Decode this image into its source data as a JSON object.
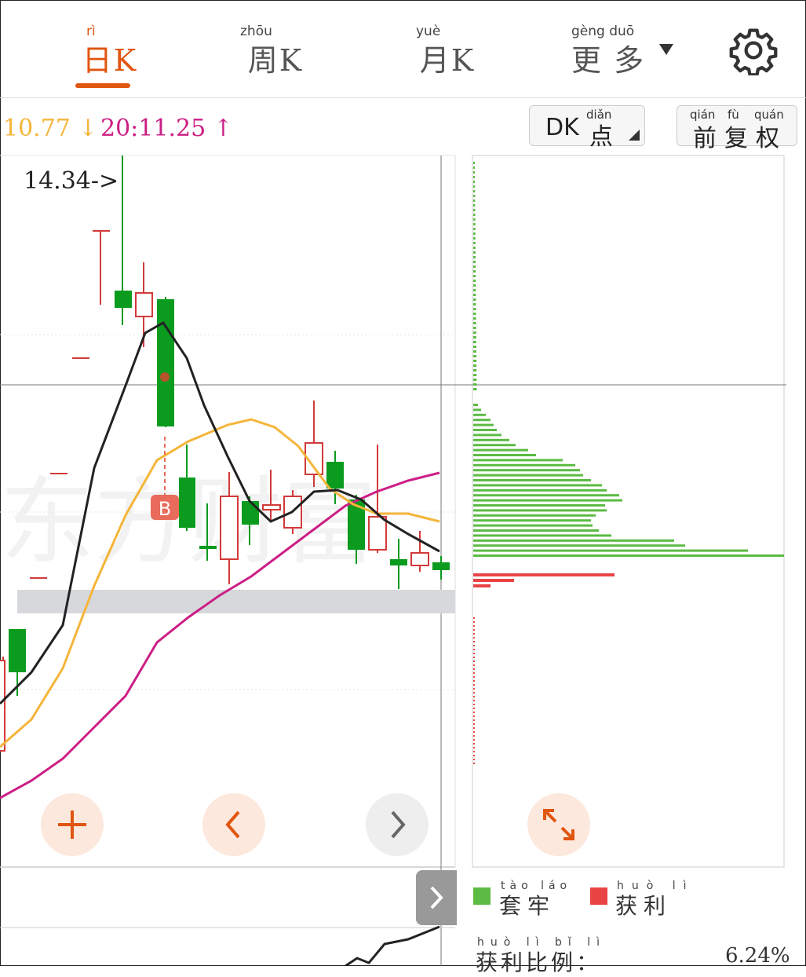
{
  "tabs": [
    {
      "pinyin": "rì",
      "label": "日K",
      "active": true
    },
    {
      "pinyin": "zhōu",
      "label": "周K",
      "active": false
    },
    {
      "pinyin": "yuè",
      "label": "月K",
      "active": false
    },
    {
      "pinyin": "gèng duō",
      "label": "更 多",
      "active": false
    }
  ],
  "ma_values": {
    "ma10": "10.77",
    "ma10_arrow": "↓",
    "ma20": "20:11.25",
    "ma20_arrow": "↑"
  },
  "dk_button": {
    "label": "DK",
    "char": "点",
    "pinyin": "diǎn"
  },
  "fq_button": {
    "chars": "前复权",
    "pinyin": [
      "qián",
      "fù",
      "quán"
    ]
  },
  "chart": {
    "high_label": "14.34->",
    "buy_marker": "B",
    "watermark": "东方财富"
  },
  "legend": {
    "trapped": {
      "pinyin": "tào láo",
      "label": "套牢",
      "color": "#5cbb44"
    },
    "profit": {
      "pinyin": "huò lì",
      "label": "获利",
      "color": "#e84444"
    }
  },
  "profit_ratio": {
    "pinyin": "huò lì bǐ lì",
    "label": "获利比例：",
    "value": "6.24%"
  },
  "colors": {
    "accent": "#e0550f",
    "up": "#d23a3a",
    "down": "#0a9b1f",
    "ma5": "#222222",
    "ma10": "#f5b53a",
    "ma20": "#cc1f86"
  },
  "icons": [
    "gear-icon",
    "plus-icon",
    "chevron-left-icon",
    "chevron-right-icon",
    "expand-icon",
    "dropdown-triangle-icon"
  ]
}
